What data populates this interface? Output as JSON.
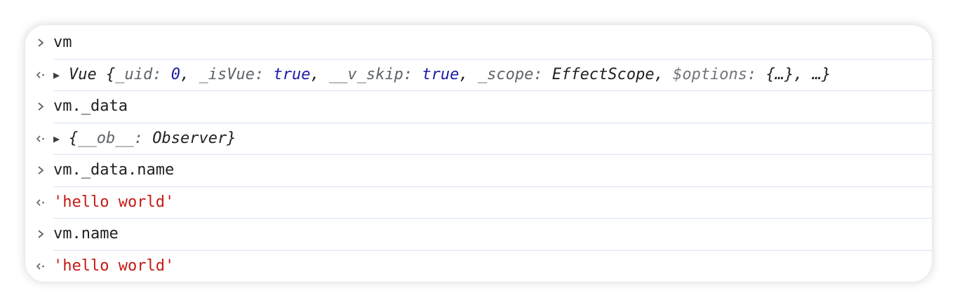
{
  "console": {
    "rows": [
      {
        "type": "input",
        "text": "vm"
      },
      {
        "type": "output-object",
        "prefix": "Vue {",
        "entries": [
          {
            "key": "_uid",
            "value": "0",
            "kind": "number"
          },
          {
            "key": "_isVue",
            "value": "true",
            "kind": "keyword"
          },
          {
            "key": "__v_skip",
            "value": "true",
            "kind": "keyword"
          },
          {
            "key": "_scope",
            "value": "EffectScope",
            "kind": "text"
          },
          {
            "key": "$options",
            "value": "{…}",
            "kind": "text"
          }
        ],
        "suffix": "…}"
      },
      {
        "type": "input",
        "text": "vm._data"
      },
      {
        "type": "output-object",
        "prefix": "{",
        "entries": [
          {
            "key": "__ob__",
            "value": "Observer",
            "kind": "text"
          }
        ],
        "suffix": "}"
      },
      {
        "type": "input",
        "text": "vm._data.name"
      },
      {
        "type": "output-string",
        "text": "'hello world'"
      },
      {
        "type": "input",
        "text": "vm.name"
      },
      {
        "type": "output-string",
        "text": "'hello world'"
      }
    ]
  },
  "colors": {
    "string": "#c41a16",
    "keyword": "#1a1aa6",
    "key": "#5f6368",
    "separator": "#d6e2f5"
  }
}
